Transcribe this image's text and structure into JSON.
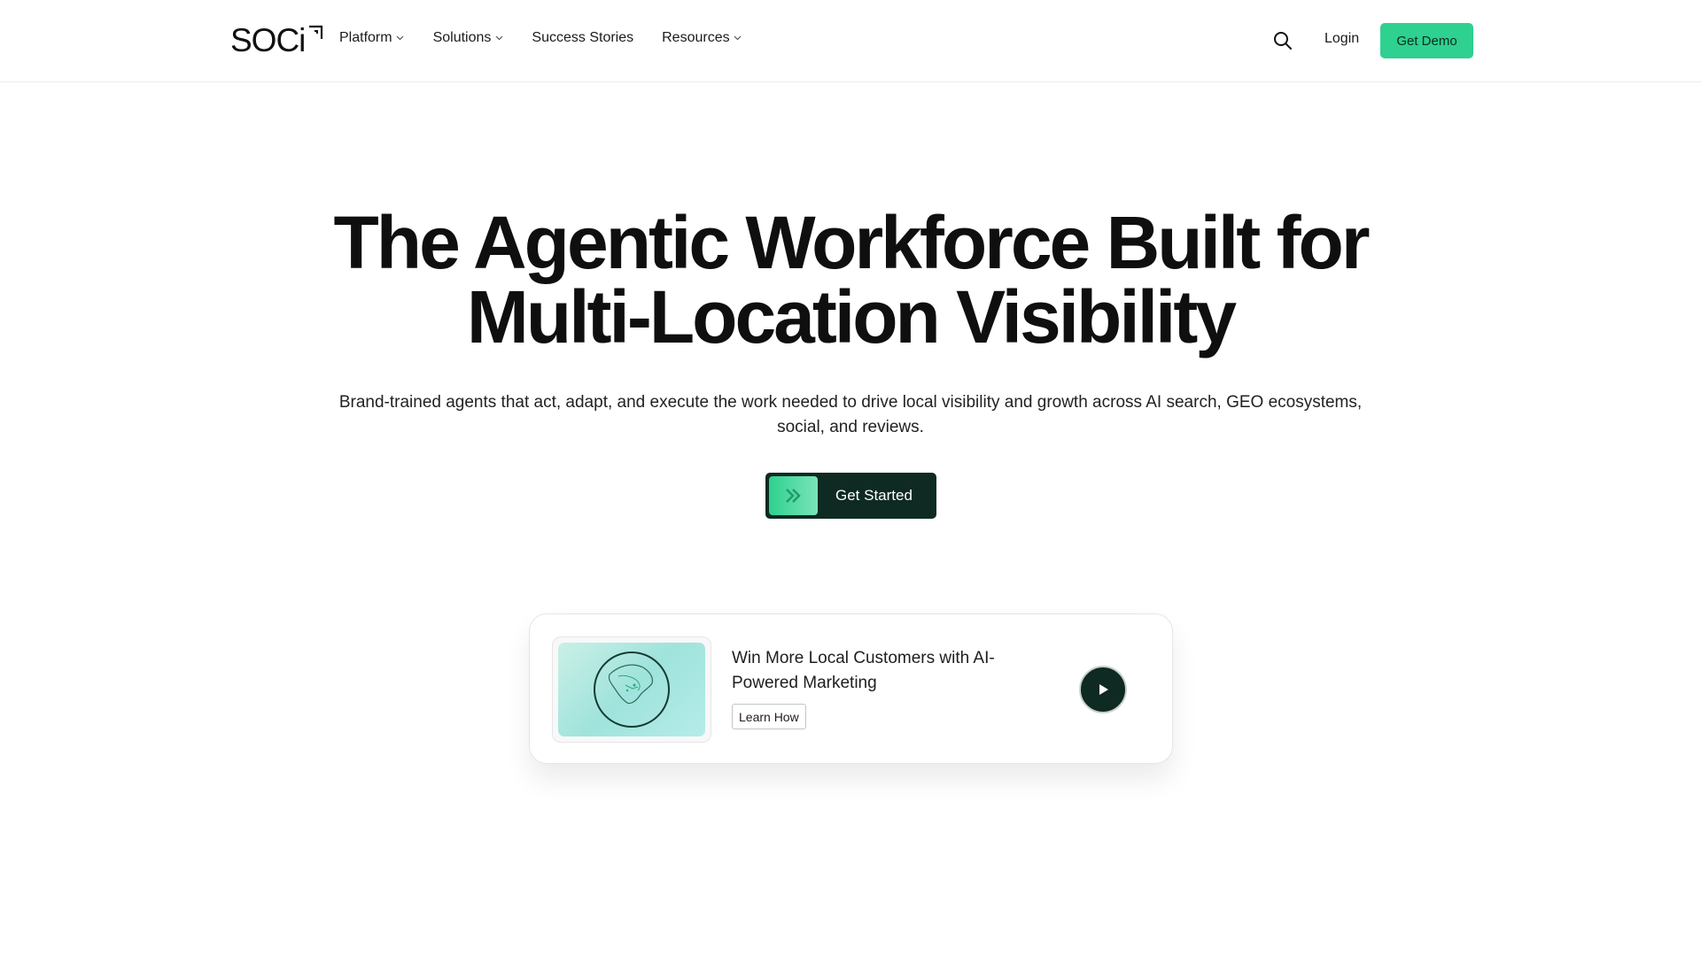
{
  "brand": {
    "logo_text": "SOCi",
    "accent": "#2ed18f",
    "dark": "#0e2a22"
  },
  "nav": {
    "items": [
      {
        "label": "Platform",
        "has_dropdown": true
      },
      {
        "label": "Solutions",
        "has_dropdown": true
      },
      {
        "label": "Success Stories",
        "has_dropdown": false
      },
      {
        "label": "Resources",
        "has_dropdown": true
      }
    ],
    "search_icon": "search-icon",
    "login_label": "Login",
    "demo_label": "Get Demo"
  },
  "hero": {
    "title_line1": "The Agentic Workforce Built for",
    "title_line2": "Multi-Location Visibility",
    "subtitle": "Brand-trained agents that act, adapt, and execute the work needed to drive local visibility and growth across AI search, GEO ecosystems, social, and reviews.",
    "cta_label": "Get Started",
    "cta_icon": "double-chevron-right-icon"
  },
  "video_card": {
    "thumbnail_icon": "globe-icon",
    "title": "Win More Local Customers with AI-Powered Marketing",
    "button_label": "Learn How",
    "play_icon": "play-icon"
  }
}
